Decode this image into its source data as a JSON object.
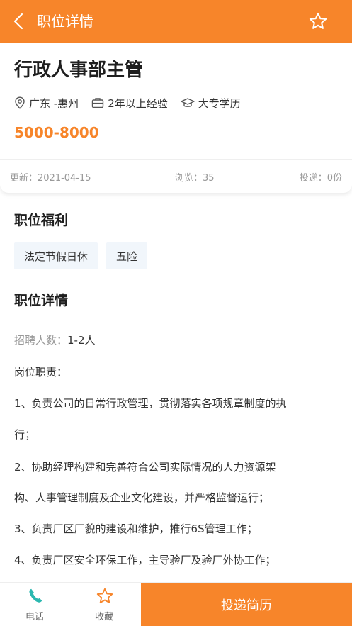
{
  "header": {
    "title": "职位详情",
    "back_icon": "chevron-left-icon",
    "favorite_icon": "star-outline-icon"
  },
  "job": {
    "title": "行政人事部主管",
    "location": "广东 -惠州",
    "experience": "2年以上经验",
    "education": "大专学历",
    "salary": "5000-8000",
    "stats": {
      "updated": "更新：2021-04-15",
      "views": "浏览：35",
      "applications": "投递：0份"
    }
  },
  "benefits": {
    "title": "职位福利",
    "tags": [
      "法定节假日休",
      "五险"
    ]
  },
  "details": {
    "title": "职位详情",
    "headcount_label": "招聘人数：",
    "headcount_value": "1-2人",
    "duties_label": "岗位职责：",
    "lines": [
      "1、负责公司的日常行政管理，贯彻落实各项规章制度的执",
      "行；",
      "2、协助经理构建和完善符合公司实际情况的人力资源架",
      "构、人事管理制度及企业文化建设，并严格监督运行；",
      "3、负责厂区厂貌的建设和维护，推行6S管理工作；",
      "4、负责厂区安全环保工作，主导验厂及验厂外协工作；"
    ]
  },
  "bottom_bar": {
    "phone_label": "电话",
    "favorite_label": "收藏",
    "apply_label": "投递简历"
  },
  "colors": {
    "accent": "#f7852a",
    "phone_icon": "#2bb8b0",
    "tag_bg": "#f1f6fb"
  }
}
